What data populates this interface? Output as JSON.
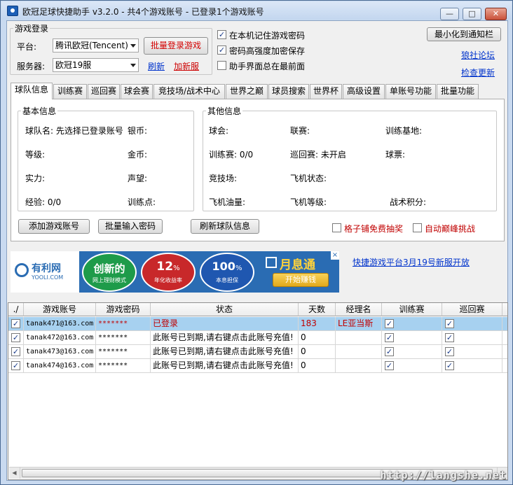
{
  "window": {
    "title": "欧冠足球快捷助手 v3.2.0  - 共4个游戏账号 - 已登录1个游戏账号",
    "minimize": "—",
    "maximize": "□",
    "close": "✕"
  },
  "login": {
    "group_label": "游戏登录",
    "platform_label": "平台:",
    "platform_value": "腾讯欧冠(Tencent)",
    "server_label": "服务器:",
    "server_value": "欧冠19服",
    "batch_login": "批量登录游戏",
    "refresh": "刷新",
    "add_server": "加新服"
  },
  "options": {
    "remember": {
      "label": "在本机记住游戏密码",
      "checked": true
    },
    "encrypt": {
      "label": "密码高强度加密保存",
      "checked": true
    },
    "topmost": {
      "label": "助手界面总在最前面",
      "checked": false
    }
  },
  "right": {
    "minimize_tray": "最小化到通知栏",
    "forum": "狼社论坛",
    "check_update": "检查更新"
  },
  "tabs": [
    "球队信息",
    "训练赛",
    "巡回赛",
    "球会赛",
    "竞技场/战术中心",
    "世界之巅",
    "球员搜索",
    "世界杯",
    "高级设置",
    "单账号功能",
    "批量功能"
  ],
  "basic": {
    "title": "基本信息",
    "team_name": "球队名: 先选择已登录账号",
    "silver": "银币:",
    "level": "等级:",
    "gold": "金币:",
    "strength": "实力:",
    "prestige": "声望:",
    "exp": "经验: 0/0",
    "training_points": "训练点:"
  },
  "other": {
    "title": "其他信息",
    "club": "球会:",
    "league": "联赛:",
    "training_base": "训练基地:",
    "training_match": "训练赛: 0/0",
    "tour": "巡回赛: 未开启",
    "tickets": "球票:",
    "arena": "竞技场:",
    "plane_status": "飞机状态:",
    "plane_fuel": "飞机油量:",
    "plane_level": "飞机等级:",
    "tactic_points": "战术积分:"
  },
  "actions": {
    "add_account": "添加游戏账号",
    "batch_password": "批量输入密码",
    "refresh_team": "刷新球队信息",
    "lottery": {
      "label": "格子铺免费抽奖",
      "checked": false
    },
    "peak": {
      "label": "自动巅峰挑战",
      "checked": false
    }
  },
  "ad": {
    "brand": "有利网",
    "brand_en": "YOOLI.COM",
    "c1_big": "创新的",
    "c1_small": "网上理财模式",
    "c2_big": "12",
    "c2_unit": "%",
    "c2_small": "年化收益率",
    "c3_big": "100",
    "c3_unit": "%",
    "c3_small": "本息担保",
    "logo": "月息通",
    "cta": "开始赚钱",
    "link": "快捷游戏平台3月19号新服开放",
    "close": "×"
  },
  "table": {
    "headers": [
      "./",
      "游戏账号",
      "游戏密码",
      "状态",
      "天数",
      "经理名",
      "训练赛",
      "巡回赛"
    ],
    "rows": [
      {
        "account": "tanak471@163.com",
        "password": "*******",
        "status": "已登录",
        "days": "183",
        "manager": "LE亚当斯",
        "checked": true,
        "selected": true
      },
      {
        "account": "tanak472@163.com",
        "password": "*******",
        "status": "此账号已到期,请右键点击此账号充值!",
        "days": "0",
        "manager": "",
        "checked": true,
        "selected": false
      },
      {
        "account": "tanak473@163.com",
        "password": "*******",
        "status": "此账号已到期,请右键点击此账号充值!",
        "days": "0",
        "manager": "",
        "checked": true,
        "selected": false
      },
      {
        "account": "tanak474@163.com",
        "password": "*******",
        "status": "此账号已到期,请右键点击此账号充值!",
        "days": "0",
        "manager": "",
        "checked": true,
        "selected": false
      }
    ]
  },
  "watermark": "http://langshe.net"
}
